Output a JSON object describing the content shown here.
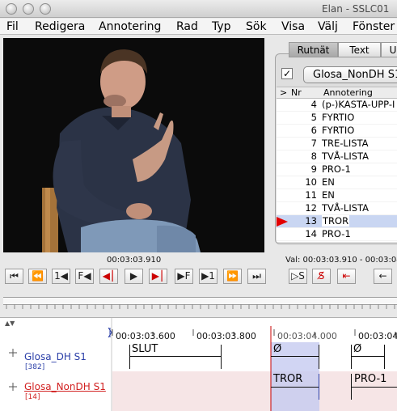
{
  "window": {
    "title": "Elan - SSLC01"
  },
  "menu": [
    "Fil",
    "Redigera",
    "Annotering",
    "Rad",
    "Typ",
    "Sök",
    "Visa",
    "Välj",
    "Fönster"
  ],
  "media": {
    "current_time": "00:03:03.910",
    "selection": "Val: 00:03:03.910 - 00:03:04."
  },
  "tabs": [
    "Rutnät",
    "Text",
    "U"
  ],
  "grid": {
    "checkbox": "✓",
    "tier": "Glosa_NonDH S1",
    "columns": [
      ">",
      "Nr",
      "Annotering"
    ],
    "rows": [
      {
        "nr": "4",
        "annotation": "(p-)KASTA-UPP-I"
      },
      {
        "nr": "5",
        "annotation": "FYRTIO"
      },
      {
        "nr": "6",
        "annotation": "FYRTIO"
      },
      {
        "nr": "7",
        "annotation": "TRE-LISTA"
      },
      {
        "nr": "8",
        "annotation": "TVÅ-LISTA"
      },
      {
        "nr": "9",
        "annotation": "PRO-1"
      },
      {
        "nr": "10",
        "annotation": "EN"
      },
      {
        "nr": "11",
        "annotation": "EN"
      },
      {
        "nr": "12",
        "annotation": "TVÅ-LISTA"
      },
      {
        "nr": "13",
        "annotation": "TROR",
        "selected": true
      },
      {
        "nr": "14",
        "annotation": "PRO-1"
      }
    ]
  },
  "controls": [
    "⎮◀◀",
    "◀⎮",
    "1◀",
    "F◀",
    "◀⎮",
    "▶",
    "▶⎮",
    "▶F",
    "▶1",
    "▶⎮",
    "▶▶⎮",
    "⎮S",
    "S",
    "⟵",
    "←"
  ],
  "timeline": {
    "ticks": [
      "00:03:03.600",
      "00:03:03.800",
      "00:03:04.000",
      "00:03:04"
    ],
    "tiers": [
      {
        "name": "Glosa_DH S1",
        "count": "[382]",
        "color": "#2b3fa8"
      },
      {
        "name": "Glosa_NonDH S1",
        "count": "[14]",
        "color": "#d22222"
      }
    ],
    "annotations": {
      "dh": [
        "SLUT",
        "Ø",
        "Ø"
      ],
      "nondh": [
        "TROR",
        "PRO-1"
      ]
    }
  }
}
